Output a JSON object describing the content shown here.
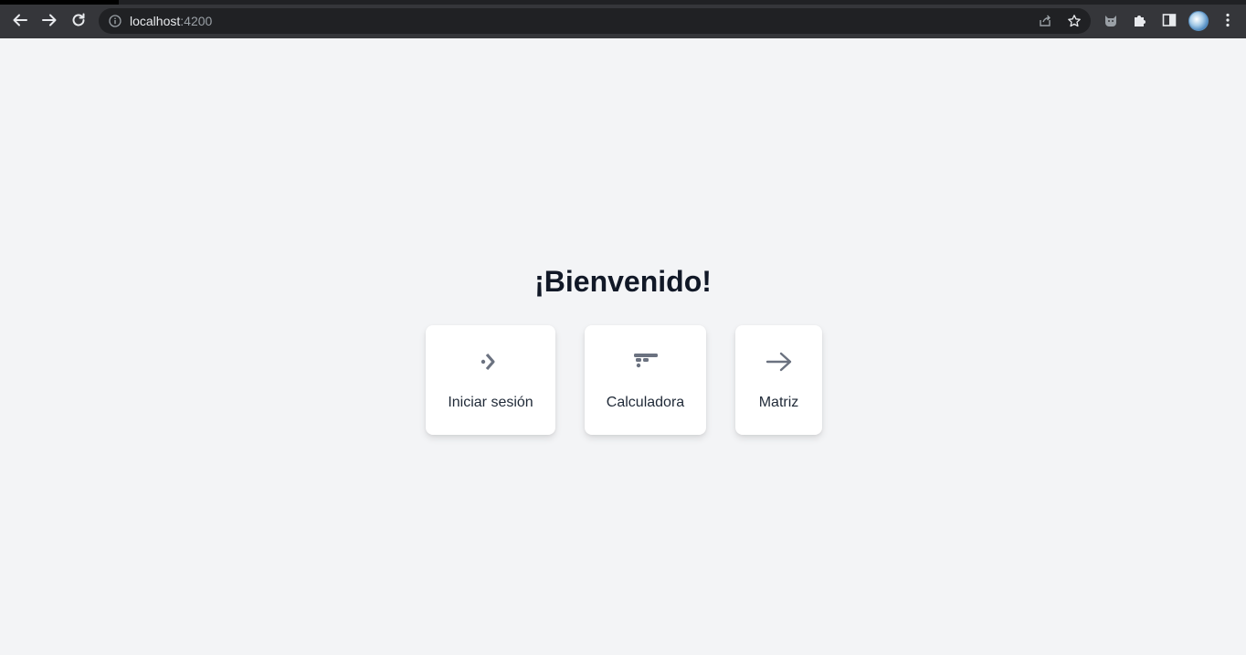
{
  "browser": {
    "url_host": "localhost",
    "url_port": ":4200"
  },
  "page": {
    "title": "¡Bienvenido!",
    "cards": [
      {
        "label": "Iniciar sesión",
        "icon": "login-chevron-icon"
      },
      {
        "label": "Calculadora",
        "icon": "calculator-icon"
      },
      {
        "label": "Matriz",
        "icon": "arrow-right-icon"
      }
    ]
  },
  "colors": {
    "page_background": "#f3f4f6",
    "card_background": "#ffffff",
    "icon_gray": "#6b7280",
    "title_text": "#111827"
  }
}
